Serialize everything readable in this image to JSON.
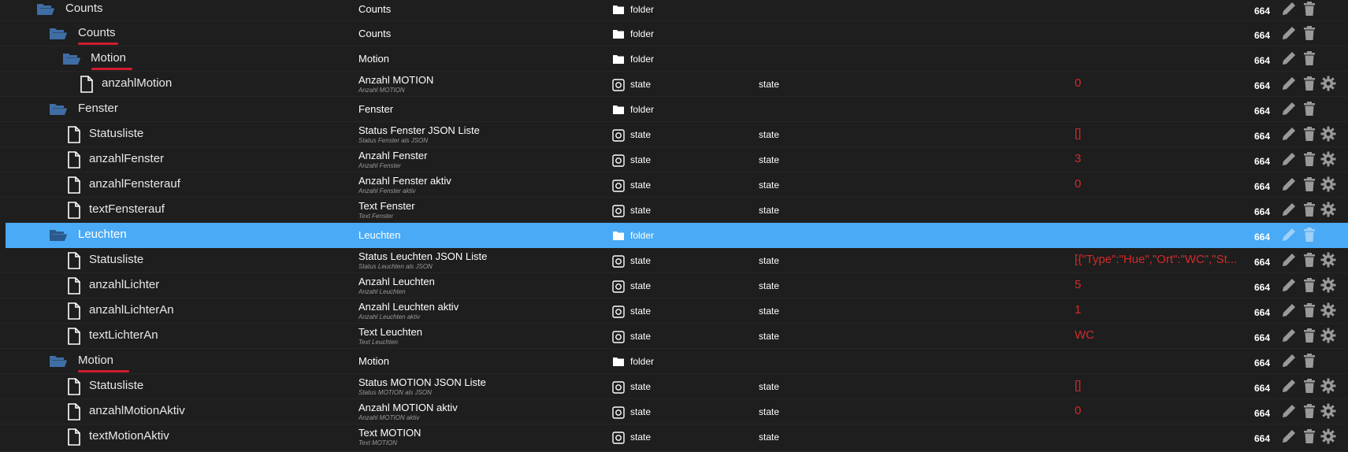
{
  "colors": {
    "background": "#1e1e1e",
    "selected_row": "#4aaaf5",
    "folder_icon": "#3f6ea5",
    "value_text": "#d42a2a",
    "action_icon": "#9a9a9a",
    "annotation_red": "#d11d2e"
  },
  "rows": [
    {
      "kind": "folder",
      "depth": 0,
      "name": "Counts",
      "title": "Counts",
      "type": "folder",
      "acl": "664",
      "underline": false
    },
    {
      "kind": "folder",
      "depth": 1,
      "name": "Counts",
      "title": "Counts",
      "type": "folder",
      "acl": "664",
      "underline": true
    },
    {
      "kind": "folder",
      "depth": 2,
      "name": "Motion",
      "title": "Motion",
      "type": "folder",
      "acl": "664",
      "underline": true
    },
    {
      "kind": "state",
      "depth": 3,
      "name": "anzahlMotion",
      "title": "Anzahl MOTION",
      "desc": "Anzahl MOTION",
      "type": "state",
      "role": "state",
      "value": "0",
      "acl": "664"
    },
    {
      "kind": "folder",
      "depth": 1,
      "name": "Fenster",
      "title": "Fenster",
      "type": "folder",
      "acl": "664",
      "underline": false
    },
    {
      "kind": "state",
      "depth": 2,
      "name": "Statusliste",
      "title": "Status Fenster JSON Liste",
      "desc": "Status Fenster als JSON",
      "type": "state",
      "role": "state",
      "value": "[]",
      "acl": "664"
    },
    {
      "kind": "state",
      "depth": 2,
      "name": "anzahlFenster",
      "title": "Anzahl Fenster",
      "desc": "Anzahl Fenster",
      "type": "state",
      "role": "state",
      "value": "3",
      "acl": "664"
    },
    {
      "kind": "state",
      "depth": 2,
      "name": "anzahlFensterauf",
      "title": "Anzahl Fenster aktiv",
      "desc": "Anzahl Fenster aktiv",
      "type": "state",
      "role": "state",
      "value": "0",
      "acl": "664"
    },
    {
      "kind": "state",
      "depth": 2,
      "name": "textFensterauf",
      "title": "Text Fenster",
      "desc": "Text Fenster",
      "type": "state",
      "role": "state",
      "value": "",
      "acl": "664"
    },
    {
      "kind": "folder",
      "depth": 1,
      "name": "Leuchten",
      "title": "Leuchten",
      "type": "folder",
      "acl": "664",
      "underline": false,
      "selected": true
    },
    {
      "kind": "state",
      "depth": 2,
      "name": "Statusliste",
      "title": "Status Leuchten JSON Liste",
      "desc": "Status Leuchten als JSON",
      "type": "state",
      "role": "state",
      "value": "[{\"Type\":\"Hue\",\"Ort\":\"WC\",\"St...",
      "acl": "664"
    },
    {
      "kind": "state",
      "depth": 2,
      "name": "anzahlLichter",
      "title": "Anzahl Leuchten",
      "desc": "Anzahl Leuchten",
      "type": "state",
      "role": "state",
      "value": "5",
      "acl": "664"
    },
    {
      "kind": "state",
      "depth": 2,
      "name": "anzahlLichterAn",
      "title": "Anzahl Leuchten aktiv",
      "desc": "Anzahl Leuchten aktiv",
      "type": "state",
      "role": "state",
      "value": "1",
      "acl": "664"
    },
    {
      "kind": "state",
      "depth": 2,
      "name": "textLichterAn",
      "title": "Text Leuchten",
      "desc": "Text Leuchten",
      "type": "state",
      "role": "state",
      "value": "WC",
      "acl": "664"
    },
    {
      "kind": "folder",
      "depth": 1,
      "name": "Motion",
      "title": "Motion",
      "type": "folder",
      "acl": "664",
      "underline": true
    },
    {
      "kind": "state",
      "depth": 2,
      "name": "Statusliste",
      "title": "Status MOTION JSON Liste",
      "desc": "Status MOTION als JSON",
      "type": "state",
      "role": "state",
      "value": "[]",
      "acl": "664"
    },
    {
      "kind": "state",
      "depth": 2,
      "name": "anzahlMotionAktiv",
      "title": "Anzahl MOTION aktiv",
      "desc": "Anzahl MOTION aktiv",
      "type": "state",
      "role": "state",
      "value": "0",
      "acl": "664"
    },
    {
      "kind": "state",
      "depth": 2,
      "name": "textMotionAktiv",
      "title": "Text MOTION",
      "desc": "Text MOTION",
      "type": "state",
      "role": "state",
      "value": "",
      "acl": "664"
    }
  ]
}
